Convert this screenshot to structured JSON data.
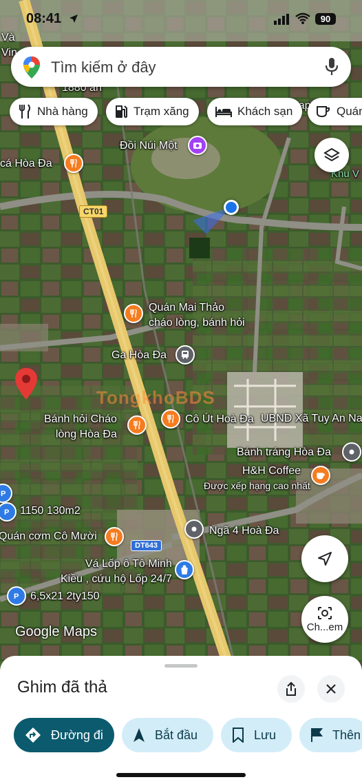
{
  "status_bar": {
    "time": "08:41",
    "battery": "90"
  },
  "search": {
    "placeholder": "Tìm kiếm ở đây"
  },
  "chips": [
    {
      "label": "Nhà hàng",
      "icon": "fork-knife-icon"
    },
    {
      "label": "Trạm xăng",
      "icon": "gas-station-icon"
    },
    {
      "label": "Khách sạn",
      "icon": "bed-icon"
    },
    {
      "label": "Quán",
      "icon": "coffee-cup-icon"
    }
  ],
  "map": {
    "road_labels": {
      "ct01": "CT01",
      "dt643": "DT643"
    },
    "places": {
      "va_vin": "Và\nVin",
      "n1880": "1880 an",
      "tap": "Tạp",
      "doi_nui_mot": "Đồi Núi Một",
      "ca_hoa_da": "cá Hòa Đa",
      "khu_v": "Khu V",
      "quan_mai_thao": "Quán Mai Thảo\ncháo lòng, bánh hỏi",
      "ga_hoa_da": "Ga Hòa Đa",
      "banh_hoi_chao": "Bánh hỏi Cháo\nlòng Hòa Đa",
      "co_ut": "Cô Út Hoà Đa",
      "ubnd": "UBND Xã Tuy An Na",
      "banh_trang": "Bánh tráng Hòa Đa",
      "hh_coffee": "H&H Coffee",
      "hh_coffee_sub": "Được xếp hạng cao nhất",
      "listing_1150": "1150 130m2",
      "quan_com": "Quán cơm Cô Mười",
      "nga4": "Ngã 4 Hoà Đa",
      "va_lop": "Vá Lốp ô Tô Minh\nKiều , cứu hộ Lốp 24/7",
      "listing_65": "6,5x21 2ty150"
    },
    "watermark": "TongkhoBDS",
    "google_logo": "Google Maps",
    "camera_label": "Ch...em"
  },
  "sheet": {
    "title": "Ghim đã thả",
    "actions": [
      {
        "label": "Đường đi",
        "icon": "directions-icon"
      },
      {
        "label": "Bắt đầu",
        "icon": "navigation-arrow-icon"
      },
      {
        "label": "Lưu",
        "icon": "bookmark-icon"
      },
      {
        "label": "Thên",
        "icon": "flag-icon"
      }
    ]
  },
  "colors": {
    "food": "#f57c1f",
    "transit": "#5f6368",
    "shop": "#2f7be5",
    "photo": "#a142f4",
    "pin": "#e53935",
    "primary_action": "#0b5a6e",
    "action_bg": "#d3edf8",
    "road": "#e7c86c"
  }
}
